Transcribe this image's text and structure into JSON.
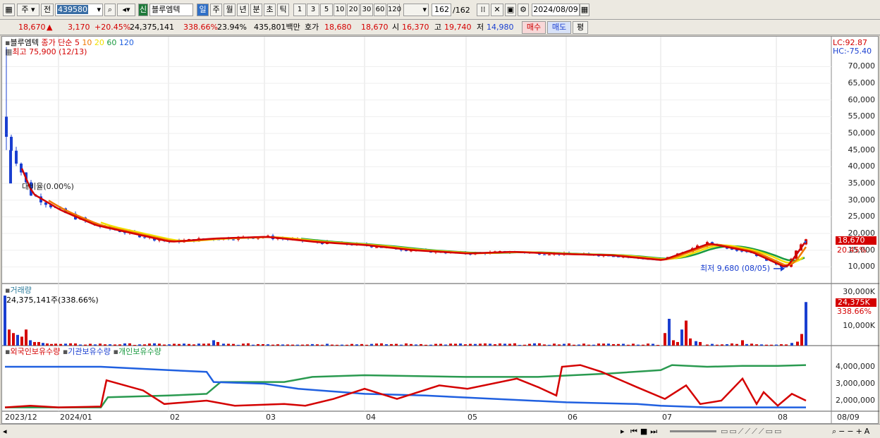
{
  "toolbar": {
    "market": "주",
    "prev_label": "전",
    "code": "439580",
    "badge_new": "신",
    "stock_name": "블루엠텍",
    "periods": [
      "일",
      "주",
      "월",
      "년",
      "분",
      "초",
      "틱"
    ],
    "active_period": "일",
    "intervals": [
      "1",
      "3",
      "5",
      "10",
      "20",
      "30",
      "60",
      "120"
    ],
    "count": "162",
    "total": "/162",
    "date": "2024/08/09"
  },
  "quote": {
    "price": "18,670",
    "change": "3,170",
    "change_pct": "+20.45%",
    "volume": "24,375,141",
    "volume_pct": "338.66%",
    "turnover": "23.94%",
    "amount": "435,801백만",
    "hoga_label": "호가",
    "ask": "18,680",
    "bid": "18,670",
    "open_label": "시",
    "open": "16,370",
    "high_label": "고",
    "high": "19,740",
    "low_label": "저",
    "low": "14,980",
    "buy": "매수",
    "sell": "매도",
    "avg": "평"
  },
  "price_panel": {
    "legend_name": "블루엠텍",
    "legend_close": "종가 단순",
    "ma_periods": [
      "5",
      "10",
      "20",
      "60",
      "120"
    ],
    "ma_colors": [
      "#d40000",
      "#f07800",
      "#f0e000",
      "#1a9a40",
      "#2060e0"
    ],
    "high_note": "최고 75,900 (12/13)",
    "low_note": "최저 9,680 (08/05)",
    "ratio_note": "대비율(0.00%)",
    "lc": "LC:92.87",
    "hc": "HC:-75.40",
    "y_ticks": [
      "70,000",
      "65,000",
      "60,000",
      "55,000",
      "50,000",
      "45,000",
      "40,000",
      "35,000",
      "30,000",
      "25,000",
      "20,000",
      "15,000",
      "10,000"
    ],
    "last_price": "18,670",
    "last_pct": "20.45%"
  },
  "volume_panel": {
    "title": "거래량",
    "value": "24,375,141주(338.66%)",
    "y_ticks": [
      "30,000K",
      "10,000K"
    ],
    "last": "24,375K",
    "last_pct": "338.66%"
  },
  "holding_panel": {
    "legend": [
      "외국인보유수량",
      "기관보유수량",
      "개인보유수량"
    ],
    "y_ticks": [
      "4,000,000",
      "3,000,000",
      "2,000,000"
    ]
  },
  "x_axis": [
    "2023/12",
    "2024/01",
    "02",
    "03",
    "04",
    "05",
    "06",
    "07",
    "08",
    "08/09"
  ],
  "chart_data": {
    "type": "line",
    "price_axis": [
      10000,
      70000
    ],
    "price_series": {
      "name": "블루엠텍",
      "x": [
        "12/13",
        "12/20",
        "01/02",
        "01/15",
        "02/01",
        "02/15",
        "03/04",
        "03/20",
        "04/02",
        "04/15",
        "05/02",
        "05/15",
        "06/03",
        "06/17",
        "07/01",
        "07/15",
        "08/01",
        "08/05",
        "08/09"
      ],
      "close": [
        50000,
        32000,
        27000,
        22500,
        17500,
        18500,
        19000,
        17500,
        16500,
        15000,
        14000,
        14500,
        13800,
        13500,
        12000,
        17000,
        14500,
        9680,
        18670
      ]
    },
    "volume_series": {
      "name": "거래량",
      "unit": "K",
      "last": 24375
    },
    "holdings": {
      "categories": [
        "2023/12",
        "2024/01",
        "02",
        "03",
        "04",
        "05",
        "06",
        "07",
        "08"
      ],
      "series": [
        {
          "name": "외국인보유수량",
          "values": [
            1600000,
            1700000,
            1800000,
            1700000,
            2300000,
            2900000,
            3900000,
            2100000,
            2000000
          ]
        },
        {
          "name": "기관보유수량",
          "values": [
            4000000,
            4000000,
            3800000,
            3000000,
            2400000,
            2200000,
            1900000,
            1700000,
            1600000
          ]
        },
        {
          "name": "개인보유수량",
          "values": [
            1600000,
            1600000,
            2300000,
            3100000,
            3400000,
            3400000,
            3500000,
            3900000,
            4050000
          ]
        }
      ]
    }
  }
}
